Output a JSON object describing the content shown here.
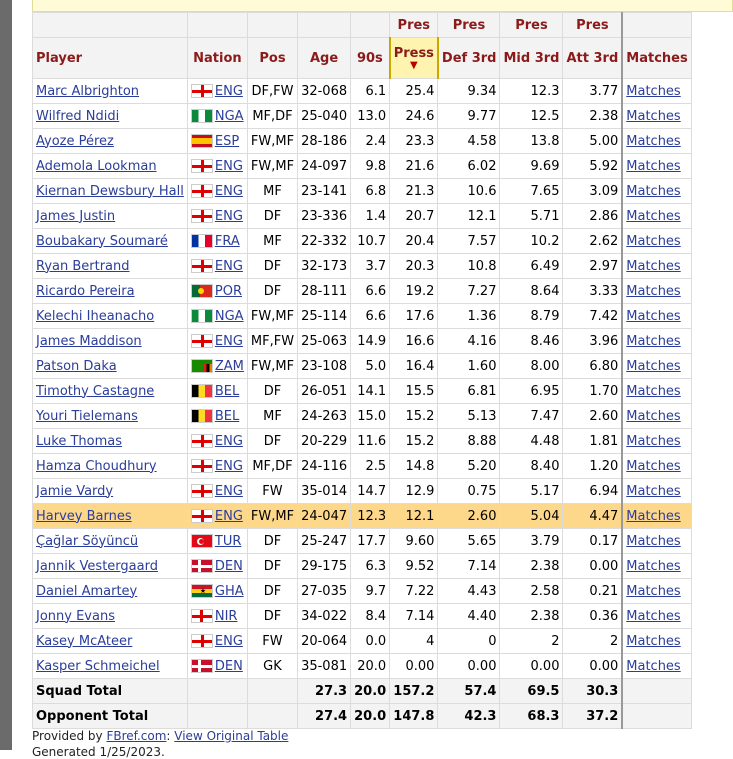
{
  "over_header": [
    "Pres",
    "Pres",
    "Pres",
    "Pres"
  ],
  "columns": {
    "player": "Player",
    "nation": "Nation",
    "pos": "Pos",
    "age": "Age",
    "nineties": "90s",
    "press": "Press",
    "press_sort_arrow": "▼",
    "def3rd": "Def 3rd",
    "mid3rd": "Mid 3rd",
    "att3rd": "Att 3rd",
    "matches": "Matches"
  },
  "highlight_color": "#fdd88b",
  "rows": [
    {
      "player": "Marc Albrighton",
      "flag": "ENG",
      "nation": "ENG",
      "pos": "DF,FW",
      "age": "32-068",
      "n90": "6.1",
      "press": "25.4",
      "def": "9.34",
      "mid": "12.3",
      "att": "3.77",
      "matches": "Matches"
    },
    {
      "player": "Wilfred Ndidi",
      "flag": "NGA",
      "nation": "NGA",
      "pos": "MF,DF",
      "age": "25-040",
      "n90": "13.0",
      "press": "24.6",
      "def": "9.77",
      "mid": "12.5",
      "att": "2.38",
      "matches": "Matches"
    },
    {
      "player": "Ayoze Pérez",
      "flag": "ESP",
      "nation": "ESP",
      "pos": "FW,MF",
      "age": "28-186",
      "n90": "2.4",
      "press": "23.3",
      "def": "4.58",
      "mid": "13.8",
      "att": "5.00",
      "matches": "Matches"
    },
    {
      "player": "Ademola Lookman",
      "flag": "ENG",
      "nation": "ENG",
      "pos": "FW,MF",
      "age": "24-097",
      "n90": "9.8",
      "press": "21.6",
      "def": "6.02",
      "mid": "9.69",
      "att": "5.92",
      "matches": "Matches"
    },
    {
      "player": "Kiernan Dewsbury Hall",
      "flag": "ENG",
      "nation": "ENG",
      "pos": "MF",
      "age": "23-141",
      "n90": "6.8",
      "press": "21.3",
      "def": "10.6",
      "mid": "7.65",
      "att": "3.09",
      "matches": "Matches"
    },
    {
      "player": "James Justin",
      "flag": "ENG",
      "nation": "ENG",
      "pos": "DF",
      "age": "23-336",
      "n90": "1.4",
      "press": "20.7",
      "def": "12.1",
      "mid": "5.71",
      "att": "2.86",
      "matches": "Matches"
    },
    {
      "player": "Boubakary Soumaré",
      "flag": "FRA",
      "nation": "FRA",
      "pos": "MF",
      "age": "22-332",
      "n90": "10.7",
      "press": "20.4",
      "def": "7.57",
      "mid": "10.2",
      "att": "2.62",
      "matches": "Matches"
    },
    {
      "player": "Ryan Bertrand",
      "flag": "ENG",
      "nation": "ENG",
      "pos": "DF",
      "age": "32-173",
      "n90": "3.7",
      "press": "20.3",
      "def": "10.8",
      "mid": "6.49",
      "att": "2.97",
      "matches": "Matches"
    },
    {
      "player": "Ricardo Pereira",
      "flag": "POR",
      "nation": "POR",
      "pos": "DF",
      "age": "28-111",
      "n90": "6.6",
      "press": "19.2",
      "def": "7.27",
      "mid": "8.64",
      "att": "3.33",
      "matches": "Matches"
    },
    {
      "player": "Kelechi Iheanacho",
      "flag": "NGA",
      "nation": "NGA",
      "pos": "FW,MF",
      "age": "25-114",
      "n90": "6.6",
      "press": "17.6",
      "def": "1.36",
      "mid": "8.79",
      "att": "7.42",
      "matches": "Matches"
    },
    {
      "player": "James Maddison",
      "flag": "ENG",
      "nation": "ENG",
      "pos": "MF,FW",
      "age": "25-063",
      "n90": "14.9",
      "press": "16.6",
      "def": "4.16",
      "mid": "8.46",
      "att": "3.96",
      "matches": "Matches"
    },
    {
      "player": "Patson Daka",
      "flag": "ZAM",
      "nation": "ZAM",
      "pos": "FW,MF",
      "age": "23-108",
      "n90": "5.0",
      "press": "16.4",
      "def": "1.60",
      "mid": "8.00",
      "att": "6.80",
      "matches": "Matches"
    },
    {
      "player": "Timothy Castagne",
      "flag": "BEL",
      "nation": "BEL",
      "pos": "DF",
      "age": "26-051",
      "n90": "14.1",
      "press": "15.5",
      "def": "6.81",
      "mid": "6.95",
      "att": "1.70",
      "matches": "Matches"
    },
    {
      "player": "Youri Tielemans",
      "flag": "BEL",
      "nation": "BEL",
      "pos": "MF",
      "age": "24-263",
      "n90": "15.0",
      "press": "15.2",
      "def": "5.13",
      "mid": "7.47",
      "att": "2.60",
      "matches": "Matches"
    },
    {
      "player": "Luke Thomas",
      "flag": "ENG",
      "nation": "ENG",
      "pos": "DF",
      "age": "20-229",
      "n90": "11.6",
      "press": "15.2",
      "def": "8.88",
      "mid": "4.48",
      "att": "1.81",
      "matches": "Matches"
    },
    {
      "player": "Hamza Choudhury",
      "flag": "ENG",
      "nation": "ENG",
      "pos": "MF,DF",
      "age": "24-116",
      "n90": "2.5",
      "press": "14.8",
      "def": "5.20",
      "mid": "8.40",
      "att": "1.20",
      "matches": "Matches"
    },
    {
      "player": "Jamie Vardy",
      "flag": "ENG",
      "nation": "ENG",
      "pos": "FW",
      "age": "35-014",
      "n90": "14.7",
      "press": "12.9",
      "def": "0.75",
      "mid": "5.17",
      "att": "6.94",
      "matches": "Matches"
    },
    {
      "player": "Harvey Barnes",
      "flag": "ENG",
      "nation": "ENG",
      "pos": "FW,MF",
      "age": "24-047",
      "n90": "12.3",
      "press": "12.1",
      "def": "2.60",
      "mid": "5.04",
      "att": "4.47",
      "matches": "Matches",
      "highlight": true
    },
    {
      "player": "Çağlar Söyüncü",
      "flag": "TUR",
      "nation": "TUR",
      "pos": "DF",
      "age": "25-247",
      "n90": "17.7",
      "press": "9.60",
      "def": "5.65",
      "mid": "3.79",
      "att": "0.17",
      "matches": "Matches"
    },
    {
      "player": "Jannik Vestergaard",
      "flag": "DEN",
      "nation": "DEN",
      "pos": "DF",
      "age": "29-175",
      "n90": "6.3",
      "press": "9.52",
      "def": "7.14",
      "mid": "2.38",
      "att": "0.00",
      "matches": "Matches"
    },
    {
      "player": "Daniel Amartey",
      "flag": "GHA",
      "nation": "GHA",
      "pos": "DF",
      "age": "27-035",
      "n90": "9.7",
      "press": "7.22",
      "def": "4.43",
      "mid": "2.58",
      "att": "0.21",
      "matches": "Matches"
    },
    {
      "player": "Jonny Evans",
      "flag": "NIR",
      "nation": "NIR",
      "pos": "DF",
      "age": "34-022",
      "n90": "8.4",
      "press": "7.14",
      "def": "4.40",
      "mid": "2.38",
      "att": "0.36",
      "matches": "Matches"
    },
    {
      "player": "Kasey McAteer",
      "flag": "ENG",
      "nation": "ENG",
      "pos": "FW",
      "age": "20-064",
      "n90": "0.0",
      "press": "4",
      "def": "0",
      "mid": "2",
      "att": "2",
      "matches": "Matches"
    },
    {
      "player": "Kasper Schmeichel",
      "flag": "DEN",
      "nation": "DEN",
      "pos": "GK",
      "age": "35-081",
      "n90": "20.0",
      "press": "0.00",
      "def": "0.00",
      "mid": "0.00",
      "att": "0.00",
      "matches": "Matches"
    }
  ],
  "totals": [
    {
      "label": "Squad Total",
      "age": "27.3",
      "n90": "20.0",
      "press": "157.2",
      "def": "57.4",
      "mid": "69.5",
      "att": "30.3"
    },
    {
      "label": "Opponent Total",
      "age": "27.4",
      "n90": "20.0",
      "press": "147.8",
      "def": "42.3",
      "mid": "68.3",
      "att": "37.2"
    }
  ],
  "footer": {
    "provided_by": "Provided by ",
    "site": "FBref.com",
    "sep": ": ",
    "view_original": "View Original Table",
    "generated": "Generated 1/25/2023."
  }
}
